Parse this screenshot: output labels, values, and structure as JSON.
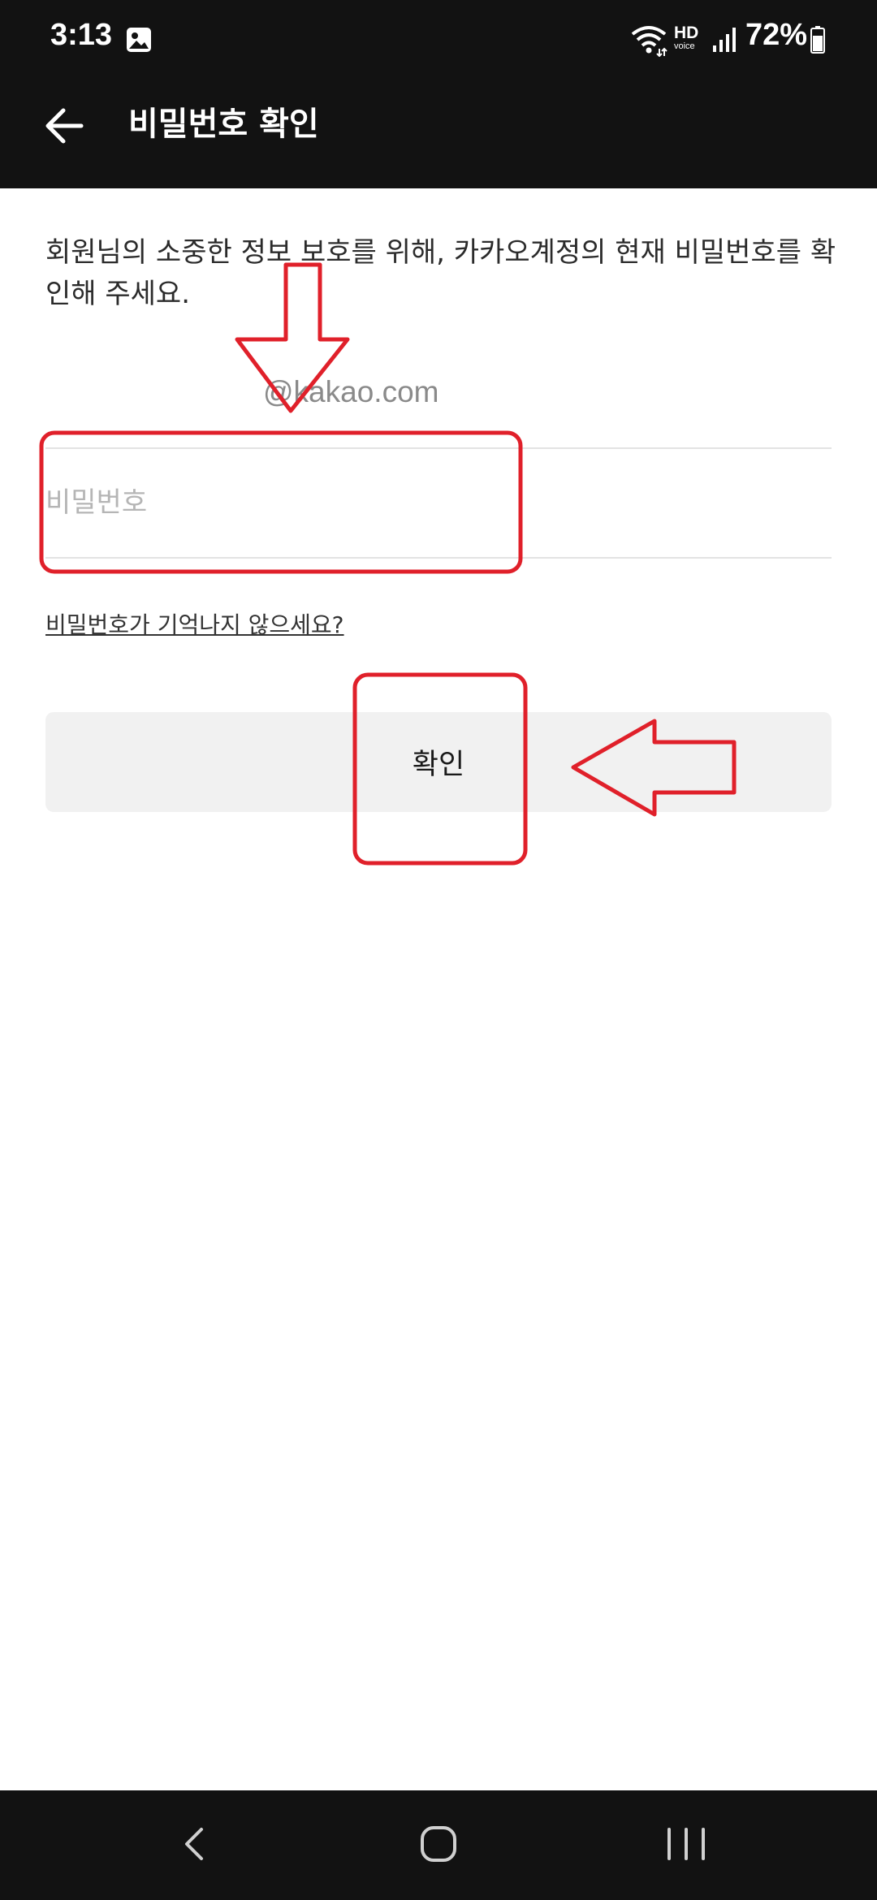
{
  "status_bar": {
    "time": "3:13",
    "battery": "72%",
    "hd_label": "HD",
    "voice_label": "voice",
    "icons": [
      "gallery-icon",
      "wifi-icon",
      "hd-voice-icon",
      "signal-icon",
      "battery-icon"
    ]
  },
  "header": {
    "title": "비밀번호 확인",
    "back_icon": "back-arrow-icon"
  },
  "main": {
    "description": "회원님의 소중한 정보 보호를 위해, 카카오계정의 현재 비밀번호를 확인해 주세요.",
    "account_email": "@kakao.com",
    "password_placeholder": "비밀번호",
    "password_value": "",
    "forgot_link": "비밀번호가 기억나지 않으세요?",
    "confirm_label": "확인"
  },
  "annotation": {
    "color": "#e0202a",
    "marks": [
      "down-arrow",
      "password-highlight-box",
      "confirm-highlight-box",
      "left-arrow"
    ]
  },
  "nav_bar": {
    "icons": [
      "nav-back-icon",
      "nav-home-icon",
      "nav-recents-icon"
    ]
  },
  "colors": {
    "bars": "#121212",
    "button_bg": "#f1f1f1",
    "placeholder": "#b5b5b5",
    "annotation": "#e0202a"
  }
}
